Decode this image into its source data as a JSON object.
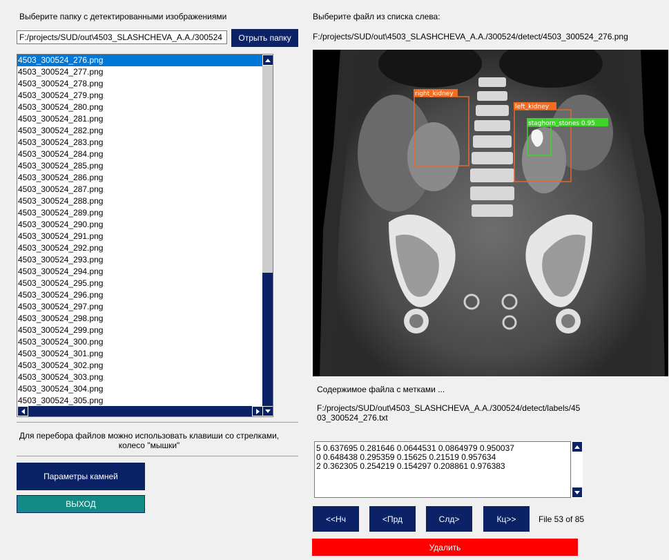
{
  "left": {
    "folder_label": "Выберите папку с детектированными изображениями",
    "folder_path": "F:/projects/SUD/out\\4503_SLASHCHEVA_A.A./300524",
    "open_button": "Отрыть папку",
    "files": [
      "4503_300524_276.png",
      "4503_300524_277.png",
      "4503_300524_278.png",
      "4503_300524_279.png",
      "4503_300524_280.png",
      "4503_300524_281.png",
      "4503_300524_282.png",
      "4503_300524_283.png",
      "4503_300524_284.png",
      "4503_300524_285.png",
      "4503_300524_286.png",
      "4503_300524_287.png",
      "4503_300524_288.png",
      "4503_300524_289.png",
      "4503_300524_290.png",
      "4503_300524_291.png",
      "4503_300524_292.png",
      "4503_300524_293.png",
      "4503_300524_294.png",
      "4503_300524_295.png",
      "4503_300524_296.png",
      "4503_300524_297.png",
      "4503_300524_298.png",
      "4503_300524_299.png",
      "4503_300524_300.png",
      "4503_300524_301.png",
      "4503_300524_302.png",
      "4503_300524_303.png",
      "4503_300524_304.png",
      "4503_300524_305.png"
    ],
    "selected_index": 0,
    "hint": "Для перебора файлов можно использовать клавиши со стрелками, колесо \"мышки\"",
    "params_button": "Параметры камней",
    "exit_button": "ВЫХОД"
  },
  "right": {
    "file_label": "Выберите файл из списка слева:",
    "file_path": "F:/projects/SUD/out\\4503_SLASHCHEVA_A.A./300524/detect/4503_300524_276.png",
    "detections": [
      {
        "label": "right_kidney",
        "color": "#f26d21"
      },
      {
        "label": "left_kidney",
        "color": "#f26d21"
      },
      {
        "label": "staghorn_stones  0.95",
        "color": "#3fd42a"
      }
    ],
    "labels_title": "Содержимое файла с метками ...",
    "labels_path": "F:/projects/SUD/out\\4503_SLASHCHEVA_A.A./300524/detect/labels/45\n03_300524_276.txt",
    "labels_lines": [
      "5 0.637695 0.281646 0.0644531 0.0864979 0.950037",
      "0 0.648438 0.295359 0.15625 0.21519 0.957634",
      "2 0.362305 0.254219 0.154297 0.208861 0.976383"
    ],
    "nav": {
      "first": "<<Нч",
      "prev": "<Прд",
      "next": "Слд>",
      "last": "Кц>>"
    },
    "file_counter": "File 53 of 85",
    "delete_button": "Удалить"
  },
  "colors": {
    "navy": "#0c2266",
    "teal": "#148a85",
    "red": "#ff0000",
    "selection": "#0078d7"
  }
}
